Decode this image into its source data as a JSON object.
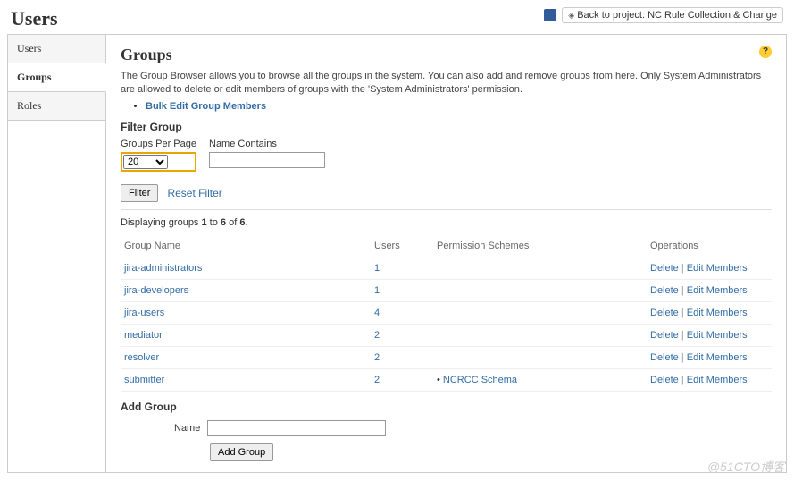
{
  "header": {
    "page_title": "Users",
    "back_link": "Back to project: NC Rule Collection & Change"
  },
  "sidebar": {
    "tabs": [
      {
        "label": "Users"
      },
      {
        "label": "Groups"
      },
      {
        "label": "Roles"
      }
    ]
  },
  "content": {
    "title": "Groups",
    "help_symbol": "?",
    "description": "The Group Browser allows you to browse all the groups in the system. You can also add and remove groups from here. Only System Administrators are allowed to delete or edit members of groups with the 'System Administrators' permission.",
    "bulk_edit_link": "Bulk Edit Group Members",
    "filter": {
      "heading": "Filter Group",
      "groups_per_page_label": "Groups Per Page",
      "groups_per_page_value": "20",
      "name_contains_label": "Name Contains",
      "name_contains_value": "",
      "filter_btn": "Filter",
      "reset_link": "Reset Filter"
    },
    "display_msg": {
      "prefix": "Displaying groups ",
      "from": "1",
      "mid1": " to ",
      "to": "6",
      "mid2": " of ",
      "total": "6",
      "suffix": "."
    },
    "table": {
      "headers": {
        "name": "Group Name",
        "users": "Users",
        "schemes": "Permission Schemes",
        "ops": "Operations"
      },
      "ops": {
        "delete": "Delete",
        "edit": "Edit Members"
      },
      "rows": [
        {
          "name": "jira-administrators",
          "users": "1",
          "scheme": ""
        },
        {
          "name": "jira-developers",
          "users": "1",
          "scheme": ""
        },
        {
          "name": "jira-users",
          "users": "4",
          "scheme": ""
        },
        {
          "name": "mediator",
          "users": "2",
          "scheme": ""
        },
        {
          "name": "resolver",
          "users": "2",
          "scheme": ""
        },
        {
          "name": "submitter",
          "users": "2",
          "scheme": "NCRCC Schema"
        }
      ]
    },
    "add": {
      "heading": "Add Group",
      "name_label": "Name",
      "name_value": "",
      "button": "Add Group"
    }
  },
  "watermark": "@51CTO博客"
}
